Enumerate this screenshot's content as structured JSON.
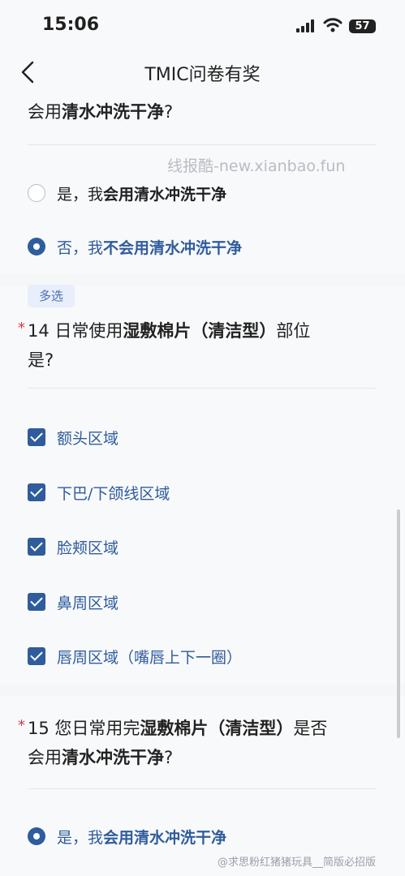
{
  "status": {
    "time": "15:06",
    "battery": "57"
  },
  "nav": {
    "title": "TMIC问卷有奖"
  },
  "q13": {
    "text_pre": "会用",
    "text_bold": "清水冲洗干净",
    "text_post": "?",
    "options": [
      {
        "pre": "是，我",
        "bold": "会用清水冲洗干净"
      },
      {
        "pre": "否，我",
        "bold": "不会用清水冲洗干净"
      }
    ]
  },
  "q14": {
    "tag": "多选",
    "required": "*",
    "line1_pre": "14 日常使用",
    "line1_bold": "湿敷棉片（清洁型）",
    "line1_post": "部位",
    "line2": "是?",
    "options": [
      "额头区域",
      "下巴/下颌线区域",
      "脸颊区域",
      "鼻周区域",
      "唇周区域（嘴唇上下一圈）"
    ]
  },
  "q15": {
    "required": "*",
    "line1_pre": "15 您日常用完",
    "line1_bold": "湿敷棉片（清洁型）",
    "line1_post": "是否",
    "line2_pre": "会用",
    "line2_bold": "清水冲洗干净",
    "line2_post": "?",
    "options": [
      {
        "pre": "是，我",
        "bold": "会用清水冲洗干净"
      }
    ]
  },
  "watermark": "线报酷-new.xianbao.fun",
  "weibo_mark": "@求思粉红猪猪玩具__简版必招版",
  "colors": {
    "accent": "#2f5c9c",
    "required": "#d9363e",
    "tag_bg": "#e9eefb"
  }
}
